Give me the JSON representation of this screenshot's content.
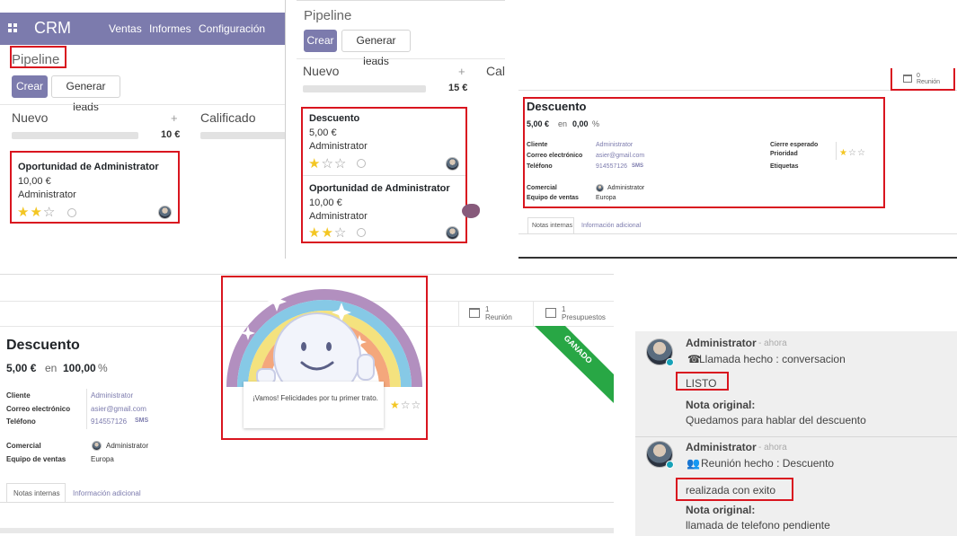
{
  "panel1": {
    "navbar": {
      "brand": "CRM",
      "menu": [
        "Ventas",
        "Informes",
        "Configuración"
      ]
    },
    "breadcrumb": "Pipeline",
    "buttons": {
      "create": "Crear",
      "generate": "Generar leads"
    },
    "columns": [
      {
        "title": "Nuevo",
        "sum": "10 €"
      },
      {
        "title": "Calificado"
      }
    ],
    "card": {
      "title": "Oportunidad de Administrator",
      "amount": "10,00 €",
      "owner": "Administrator",
      "stars": 2,
      "max_stars": 3
    }
  },
  "panel2": {
    "breadcrumb": "Pipeline",
    "buttons": {
      "create": "Crear",
      "generate": "Generar leads"
    },
    "columns": [
      {
        "title": "Nuevo",
        "sum": "15 €"
      },
      {
        "title": "Cali"
      }
    ],
    "cards": [
      {
        "title": "Descuento",
        "amount": "5,00 €",
        "owner": "Administrator",
        "stars": 1,
        "max_stars": 3
      },
      {
        "title": "Oportunidad de Administrator",
        "amount": "10,00 €",
        "owner": "Administrator",
        "stars": 2,
        "max_stars": 3
      }
    ]
  },
  "panel3": {
    "smart_button": {
      "count": "0",
      "label": "Reunión"
    },
    "title": "Descuento",
    "revenue": "5,00 €",
    "revenue_in": "en",
    "probability": "0,00",
    "percent": "%",
    "fields_left": [
      {
        "label": "Cliente",
        "value": "Administrator"
      },
      {
        "label": "Correo electrónico",
        "value": "asier@gmail.com"
      },
      {
        "label": "Teléfono",
        "value": "914557126",
        "sms": "SMS"
      }
    ],
    "fields_right": [
      {
        "label": "Cierre esperado",
        "value": ""
      },
      {
        "label": "Prioridad",
        "value": ""
      },
      {
        "label": "Etiquetas",
        "value": ""
      }
    ],
    "priority_stars": 1,
    "sales": [
      {
        "label": "Comercial",
        "value": "Administrator"
      },
      {
        "label": "Equipo de ventas",
        "value": "Europa"
      }
    ],
    "tabs": [
      "Notas internas",
      "Información adicional"
    ]
  },
  "panel4": {
    "smart_buttons": [
      {
        "count": "1",
        "label": "Reunión"
      },
      {
        "count": "1",
        "label": "Presupuestos"
      }
    ],
    "ribbon": "GANADO",
    "title": "Descuento",
    "revenue": "5,00 €",
    "revenue_in": "en",
    "probability": "100,00",
    "percent": "%",
    "fields_left": [
      {
        "label": "Cliente",
        "value": "Administrator"
      },
      {
        "label": "Correo electrónico",
        "value": "asier@gmail.com"
      },
      {
        "label": "Teléfono",
        "value": "914557126",
        "sms": "SMS"
      }
    ],
    "sales": [
      {
        "label": "Comercial",
        "value": "Administrator"
      },
      {
        "label": "Equipo de ventas",
        "value": "Europa"
      }
    ],
    "priority_stars": 1,
    "tabs": [
      "Notas internas",
      "Información adicional"
    ],
    "rainbow_message": "¡Vamos! Felicidades por tu primer trato."
  },
  "panel5": {
    "messages": [
      {
        "author": "Administrator",
        "time": "- ahora",
        "activity": "Llamada hecho : conversacion",
        "feedback": "LISTO",
        "original_label": "Nota original:",
        "original": "Quedamos para hablar del descuento"
      },
      {
        "author": "Administrator",
        "time": "- ahora",
        "activity": "Reunión hecho : Descuento",
        "feedback": "realizada con exito",
        "original_label": "Nota original:",
        "original": "llamada de telefono pendiente"
      }
    ]
  },
  "colors": {
    "primary": "#7c7bad",
    "highlight": "#d9151f",
    "star": "#f3c623",
    "ribbon": "#28a745"
  }
}
